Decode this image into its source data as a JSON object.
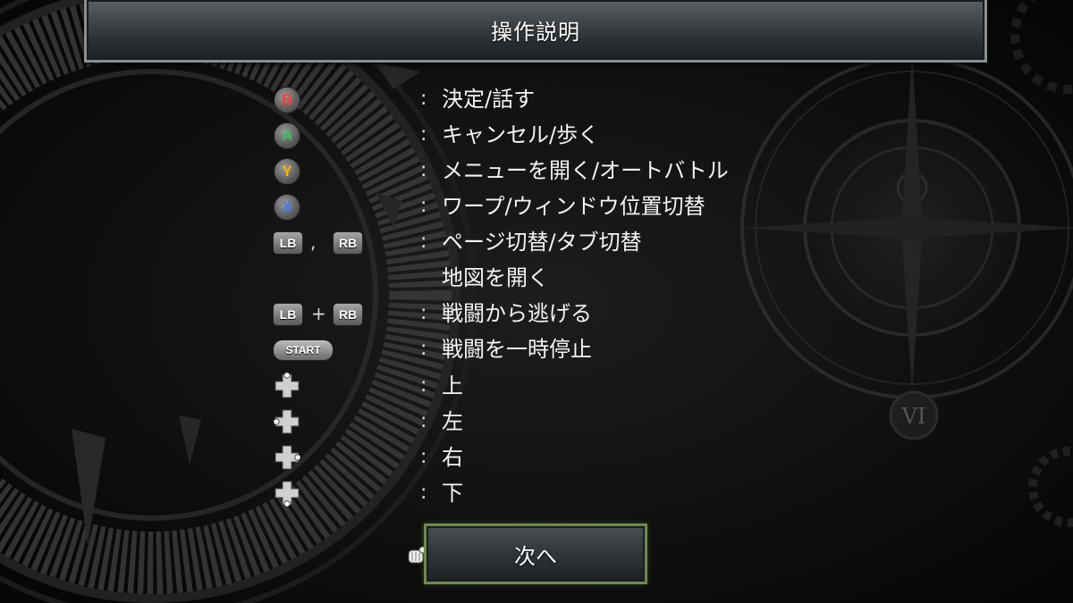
{
  "header": {
    "title": "操作説明"
  },
  "controls": [
    {
      "buttons": [
        "B"
      ],
      "button_color": "#ff3b30",
      "description": "決定/話す"
    },
    {
      "buttons": [
        "A"
      ],
      "button_color": "#34c759",
      "description": "キャンセル/歩く"
    },
    {
      "buttons": [
        "Y"
      ],
      "button_color": "#ffb300",
      "description": "メニューを開く/オートバトル"
    },
    {
      "buttons": [
        "X"
      ],
      "button_color": "#3a7bff",
      "description": "ワープ/ウィンドウ位置切替"
    },
    {
      "buttons": [
        "LB",
        "RB"
      ],
      "separator": ",",
      "description": "ページ切替/タブ切替",
      "description_line2": "地図を開く"
    },
    {
      "buttons": [
        "LB",
        "RB"
      ],
      "separator": "+",
      "description": "戦闘から逃げる"
    },
    {
      "buttons": [
        "START"
      ],
      "description": "戦闘を一時停止"
    },
    {
      "buttons": [
        "dpad-up-icon"
      ],
      "description": "上"
    },
    {
      "buttons": [
        "dpad-left-icon"
      ],
      "description": "左"
    },
    {
      "buttons": [
        "dpad-right-icon"
      ],
      "description": "右"
    },
    {
      "buttons": [
        "dpad-down-icon"
      ],
      "description": "下"
    }
  ],
  "colon": ":",
  "next_button": {
    "label": "次へ"
  },
  "cursor": {
    "icon": "pointing-hand-icon"
  },
  "background": {
    "emblem_numeral": "VI"
  },
  "colors": {
    "next_border": "#6e8a4a",
    "title_border": "#8a8f94"
  }
}
